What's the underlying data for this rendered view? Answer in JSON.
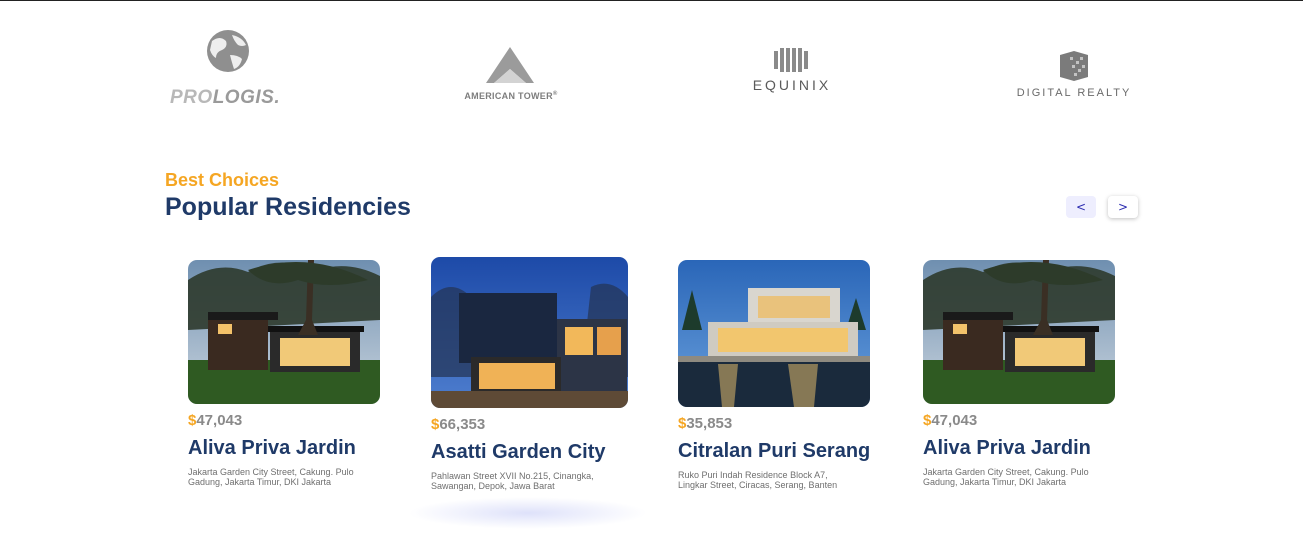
{
  "logos": {
    "prologis": {
      "icon": "globe-icon",
      "bold": "PRO",
      "rest": "LOGIS",
      "mark": "."
    },
    "american_tower": {
      "icon": "tower-icon",
      "text": "AMERICAN TOWER",
      "mark": "®"
    },
    "equinix": {
      "icon": "equinix-icon",
      "text": "EQUINIX"
    },
    "digital_realty": {
      "icon": "cube-icon",
      "text": "DIGITAL REALTY"
    }
  },
  "section": {
    "kicker": "Best Choices",
    "title": "Popular Residencies"
  },
  "carousel": {
    "prev_label": "<",
    "next_label": ">"
  },
  "currency_symbol": "$",
  "colors": {
    "accent": "#f5a623",
    "heading": "#1f3a68"
  },
  "residencies": [
    {
      "price": "47,043",
      "name": "Aliva Priva Jardin",
      "address": "Jakarta Garden City Street, Cakung. Pulo Gadung, Jakarta Timur, DKI Jakarta"
    },
    {
      "price": "66,353",
      "name": "Asatti Garden City",
      "address": "Pahlawan Street XVII No.215, Cinangka, Sawangan, Depok, Jawa Barat"
    },
    {
      "price": "35,853",
      "name": "Citralan Puri Serang",
      "address": "Ruko Puri Indah Residence Block A7, Lingkar Street, Ciracas, Serang, Banten"
    },
    {
      "price": "47,043",
      "name": "Aliva Priva Jardin",
      "address": "Jakarta Garden City Street, Cakung. Pulo Gadung, Jakarta Timur, DKI Jakarta"
    }
  ]
}
